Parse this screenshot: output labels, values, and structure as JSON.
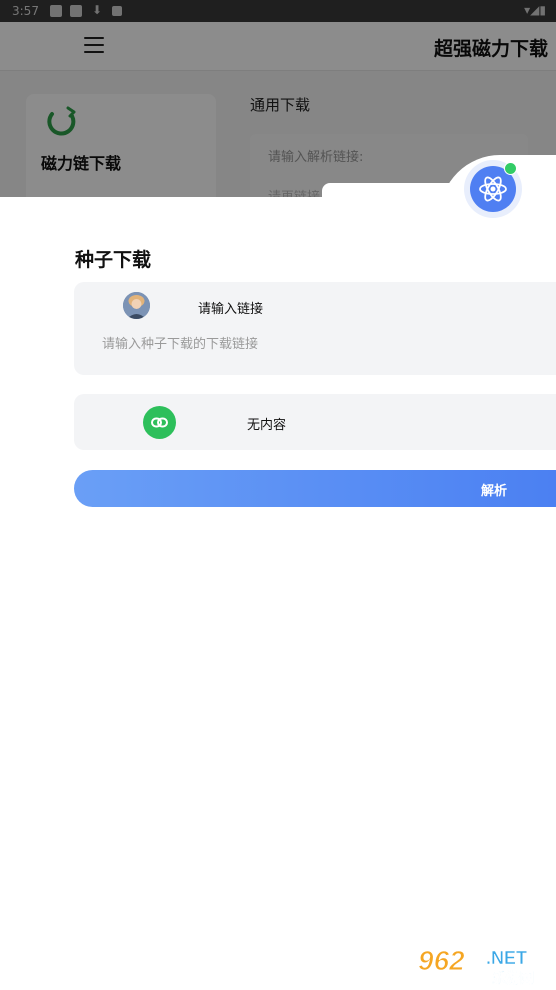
{
  "status_bar": {
    "time": "3:57"
  },
  "background_app": {
    "title": "超强磁力下载",
    "card_label": "磁力链下载",
    "section_title": "通用下载",
    "input_placeholder": "请输入解析链接:",
    "input_placeholder_partial": "请再链接"
  },
  "sheet": {
    "title": "种子下载",
    "input_label": "请输入链接",
    "input_placeholder": "请输入种子下载的下载链接",
    "result_text": "无内容",
    "parse_button": "解析"
  },
  "watermark": {
    "brand_number": "962",
    "brand_suffix": ".NET",
    "brand_cn": "乐游网"
  },
  "colors": {
    "accent": "#4f7ff2",
    "green": "#2dbf5b",
    "card_bg": "#f3f4f6"
  },
  "icons": [
    "menu-icon",
    "magnet-icon",
    "atom-icon",
    "avatar",
    "link-icon"
  ]
}
